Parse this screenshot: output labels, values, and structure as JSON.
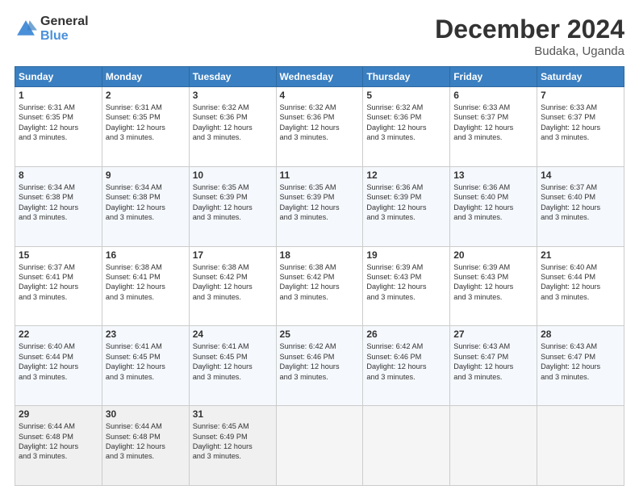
{
  "logo": {
    "general": "General",
    "blue": "Blue"
  },
  "title": "December 2024",
  "location": "Budaka, Uganda",
  "days_header": [
    "Sunday",
    "Monday",
    "Tuesday",
    "Wednesday",
    "Thursday",
    "Friday",
    "Saturday"
  ],
  "weeks": [
    [
      {
        "day": "1",
        "text": "Sunrise: 6:31 AM\nSunset: 6:35 PM\nDaylight: 12 hours\nand 3 minutes."
      },
      {
        "day": "2",
        "text": "Sunrise: 6:31 AM\nSunset: 6:35 PM\nDaylight: 12 hours\nand 3 minutes."
      },
      {
        "day": "3",
        "text": "Sunrise: 6:32 AM\nSunset: 6:36 PM\nDaylight: 12 hours\nand 3 minutes."
      },
      {
        "day": "4",
        "text": "Sunrise: 6:32 AM\nSunset: 6:36 PM\nDaylight: 12 hours\nand 3 minutes."
      },
      {
        "day": "5",
        "text": "Sunrise: 6:32 AM\nSunset: 6:36 PM\nDaylight: 12 hours\nand 3 minutes."
      },
      {
        "day": "6",
        "text": "Sunrise: 6:33 AM\nSunset: 6:37 PM\nDaylight: 12 hours\nand 3 minutes."
      },
      {
        "day": "7",
        "text": "Sunrise: 6:33 AM\nSunset: 6:37 PM\nDaylight: 12 hours\nand 3 minutes."
      }
    ],
    [
      {
        "day": "8",
        "text": "Sunrise: 6:34 AM\nSunset: 6:38 PM\nDaylight: 12 hours\nand 3 minutes."
      },
      {
        "day": "9",
        "text": "Sunrise: 6:34 AM\nSunset: 6:38 PM\nDaylight: 12 hours\nand 3 minutes."
      },
      {
        "day": "10",
        "text": "Sunrise: 6:35 AM\nSunset: 6:39 PM\nDaylight: 12 hours\nand 3 minutes."
      },
      {
        "day": "11",
        "text": "Sunrise: 6:35 AM\nSunset: 6:39 PM\nDaylight: 12 hours\nand 3 minutes."
      },
      {
        "day": "12",
        "text": "Sunrise: 6:36 AM\nSunset: 6:39 PM\nDaylight: 12 hours\nand 3 minutes."
      },
      {
        "day": "13",
        "text": "Sunrise: 6:36 AM\nSunset: 6:40 PM\nDaylight: 12 hours\nand 3 minutes."
      },
      {
        "day": "14",
        "text": "Sunrise: 6:37 AM\nSunset: 6:40 PM\nDaylight: 12 hours\nand 3 minutes."
      }
    ],
    [
      {
        "day": "15",
        "text": "Sunrise: 6:37 AM\nSunset: 6:41 PM\nDaylight: 12 hours\nand 3 minutes."
      },
      {
        "day": "16",
        "text": "Sunrise: 6:38 AM\nSunset: 6:41 PM\nDaylight: 12 hours\nand 3 minutes."
      },
      {
        "day": "17",
        "text": "Sunrise: 6:38 AM\nSunset: 6:42 PM\nDaylight: 12 hours\nand 3 minutes."
      },
      {
        "day": "18",
        "text": "Sunrise: 6:38 AM\nSunset: 6:42 PM\nDaylight: 12 hours\nand 3 minutes."
      },
      {
        "day": "19",
        "text": "Sunrise: 6:39 AM\nSunset: 6:43 PM\nDaylight: 12 hours\nand 3 minutes."
      },
      {
        "day": "20",
        "text": "Sunrise: 6:39 AM\nSunset: 6:43 PM\nDaylight: 12 hours\nand 3 minutes."
      },
      {
        "day": "21",
        "text": "Sunrise: 6:40 AM\nSunset: 6:44 PM\nDaylight: 12 hours\nand 3 minutes."
      }
    ],
    [
      {
        "day": "22",
        "text": "Sunrise: 6:40 AM\nSunset: 6:44 PM\nDaylight: 12 hours\nand 3 minutes."
      },
      {
        "day": "23",
        "text": "Sunrise: 6:41 AM\nSunset: 6:45 PM\nDaylight: 12 hours\nand 3 minutes."
      },
      {
        "day": "24",
        "text": "Sunrise: 6:41 AM\nSunset: 6:45 PM\nDaylight: 12 hours\nand 3 minutes."
      },
      {
        "day": "25",
        "text": "Sunrise: 6:42 AM\nSunset: 6:46 PM\nDaylight: 12 hours\nand 3 minutes."
      },
      {
        "day": "26",
        "text": "Sunrise: 6:42 AM\nSunset: 6:46 PM\nDaylight: 12 hours\nand 3 minutes."
      },
      {
        "day": "27",
        "text": "Sunrise: 6:43 AM\nSunset: 6:47 PM\nDaylight: 12 hours\nand 3 minutes."
      },
      {
        "day": "28",
        "text": "Sunrise: 6:43 AM\nSunset: 6:47 PM\nDaylight: 12 hours\nand 3 minutes."
      }
    ],
    [
      {
        "day": "29",
        "text": "Sunrise: 6:44 AM\nSunset: 6:48 PM\nDaylight: 12 hours\nand 3 minutes."
      },
      {
        "day": "30",
        "text": "Sunrise: 6:44 AM\nSunset: 6:48 PM\nDaylight: 12 hours\nand 3 minutes."
      },
      {
        "day": "31",
        "text": "Sunrise: 6:45 AM\nSunset: 6:49 PM\nDaylight: 12 hours\nand 3 minutes."
      },
      {
        "day": "",
        "text": ""
      },
      {
        "day": "",
        "text": ""
      },
      {
        "day": "",
        "text": ""
      },
      {
        "day": "",
        "text": ""
      }
    ]
  ]
}
